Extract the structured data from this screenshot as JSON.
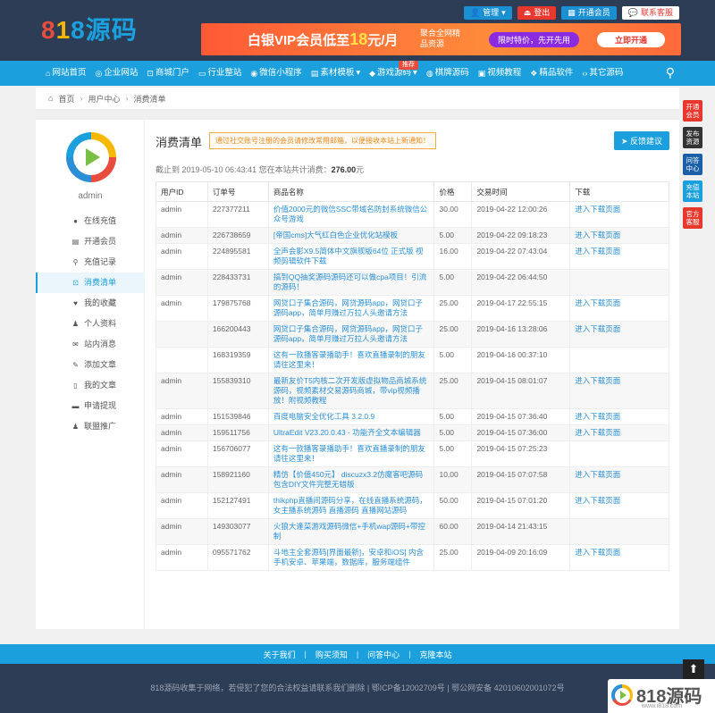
{
  "logo": {
    "digit1": "8",
    "digit2": "1",
    "digit3": "8",
    "text": "源码"
  },
  "topbar": {
    "manage": "管理",
    "logout": "登出",
    "vip": "开通会员",
    "service": "联系客服"
  },
  "banner": {
    "title_pre": "白银VIP会员低至",
    "title_num": "18",
    "title_post": "元/月",
    "sub": "聚合全网精品资源",
    "pill": "限时特价，先开先用",
    "button": "立即开通"
  },
  "nav": {
    "items": [
      "网站首页",
      "企业网站",
      "商城门户",
      "行业整站",
      "微信小程序",
      "素材模板",
      "游戏源码",
      "棋牌源码",
      "视频教程",
      "精品软件",
      "其它源码"
    ],
    "badge": "推荐"
  },
  "breadcrumb": {
    "home": "首页",
    "center": "用户中心",
    "current": "消费清单"
  },
  "side_float": [
    "开通会员",
    "发布资源",
    "问答中心",
    "充值本站",
    "官方客服"
  ],
  "sidebar": {
    "username": "admin",
    "menu": [
      "在线充值",
      "开通会员",
      "充值记录",
      "消费清单",
      "我的收藏",
      "个人资料",
      "站内消息",
      "添加文章",
      "我的文章",
      "申请提现",
      "联盟推广"
    ],
    "active_index": 3
  },
  "content": {
    "title": "消费清单",
    "notice": "通过社交账号注册的会员请修改常用邮箱，以便接收本站上新通知！",
    "feedback": "反馈建议",
    "summary_pre": "截止到 2019-05-10 06:43:41 您在本站共计消费：",
    "summary_amount": "276.00",
    "summary_post": "元",
    "columns": [
      "用户ID",
      "订单号",
      "商品名称",
      "价格",
      "交易时间",
      "下载"
    ],
    "rows": [
      {
        "user": "admin",
        "order": "227377211",
        "name": "价值2000元的微信SSC带域名防封系统微信公众号游戏",
        "price": "30.00",
        "time": "2019-04-22 12:00:26",
        "dl": "进入下载页面"
      },
      {
        "user": "admin",
        "order": "226738659",
        "name": "[帝国cms]大气红白色企业优化站模板",
        "price": "5.00",
        "time": "2019-04-22 09:18:23",
        "dl": "进入下载页面"
      },
      {
        "user": "admin",
        "order": "224895581",
        "name": "全声会影X9.5简体中文旗舰版64位 正式版 视频剪辑软件下载",
        "price": "16.00",
        "time": "2019-04-22 07:43:04",
        "dl": "进入下载页面"
      },
      {
        "user": "admin",
        "order": "228433731",
        "name": "搞到QQ抽奖源码源码还可以做cpa项目！引流的源码！",
        "price": "5.00",
        "time": "2019-04-22 06:44:50",
        "dl": ""
      },
      {
        "user": "admin",
        "order": "179875768",
        "name": "网贷口子集合源码，网贷源码app，网贷口子源码app，简单月赚过万拉人头邀请方法",
        "price": "25.00",
        "time": "2019-04-17 22:55:15",
        "dl": "进入下载页面"
      },
      {
        "user": "",
        "order": "166200443",
        "name": "网贷口子集合源码，网贷源码app，网贷口子源码app，简单月赚过万拉人头邀请方法",
        "price": "25.00",
        "time": "2019-04-16 13:28:06",
        "dl": "进入下载页面"
      },
      {
        "user": "",
        "order": "168319359",
        "name": "这有一款播客录播助手！喜欢直播录制的朋友请往这里来！",
        "price": "5.00",
        "time": "2019-04-16 00:37:10",
        "dl": ""
      },
      {
        "user": "admin",
        "order": "155839310",
        "name": "最新友价T5内核二次开发版虚拟物品商城系统源码，视频素材交易源码商城，带vip视频播放！附视频教程",
        "price": "25.00",
        "time": "2019-04-15 08:01:07",
        "dl": "进入下载页面"
      },
      {
        "user": "admin",
        "order": "151539846",
        "name": "百度电脑安全优化工具 3.2.0.9",
        "price": "5.00",
        "time": "2019-04-15 07:36:40",
        "dl": "进入下载页面"
      },
      {
        "user": "admin",
        "order": "159511756",
        "name": "UltraEdit V23.20.0.43 - 功能齐全文本编辑器",
        "price": "5.00",
        "time": "2019-04-15 07:36:00",
        "dl": "进入下载页面"
      },
      {
        "user": "admin",
        "order": "156706077",
        "name": "这有一款播客录播助手！喜欢直播录制的朋友请往这里来！",
        "price": "5.00",
        "time": "2019-04-15 07:25:23",
        "dl": ""
      },
      {
        "user": "admin",
        "order": "158921160",
        "name": "精仿【价值450元】 discuzx3.2仿魔客吧源码 包含DIY文件完整无错版",
        "price": "10.00",
        "time": "2019-04-15 07:07:58",
        "dl": "进入下载页面"
      },
      {
        "user": "admin",
        "order": "152127491",
        "name": "thikphp直播间源码分享，在线直播系统源码，女主播系统源码 直播源码 直播网站源码",
        "price": "50.00",
        "time": "2019-04-15 07:01:20",
        "dl": "进入下载页面"
      },
      {
        "user": "admin",
        "order": "149303077",
        "name": "火狼大逢菜游戏源码微信+手机wap源码+带控制",
        "price": "60.00",
        "time": "2019-04-14 21:43:15",
        "dl": ""
      },
      {
        "user": "admin",
        "order": "095571762",
        "name": "斗地主全套源码[界面最新]，安卓和iOS] 内含手机安卓、苹果端，数据库，服务端组件",
        "price": "25.00",
        "time": "2019-04-09 20:16:09",
        "dl": "进入下载页面"
      }
    ]
  },
  "footer": {
    "links": [
      "关于我们",
      "购买须知",
      "问答中心",
      "克隆本站"
    ],
    "copy": "818源码收集于网络，若侵犯了您的合法权益请联系我们删除 | 鄂ICP备12002709号 | 鄂公网安备 42010602001072号"
  },
  "watermark": {
    "logo": "818源码",
    "url": "www.i818.com"
  }
}
